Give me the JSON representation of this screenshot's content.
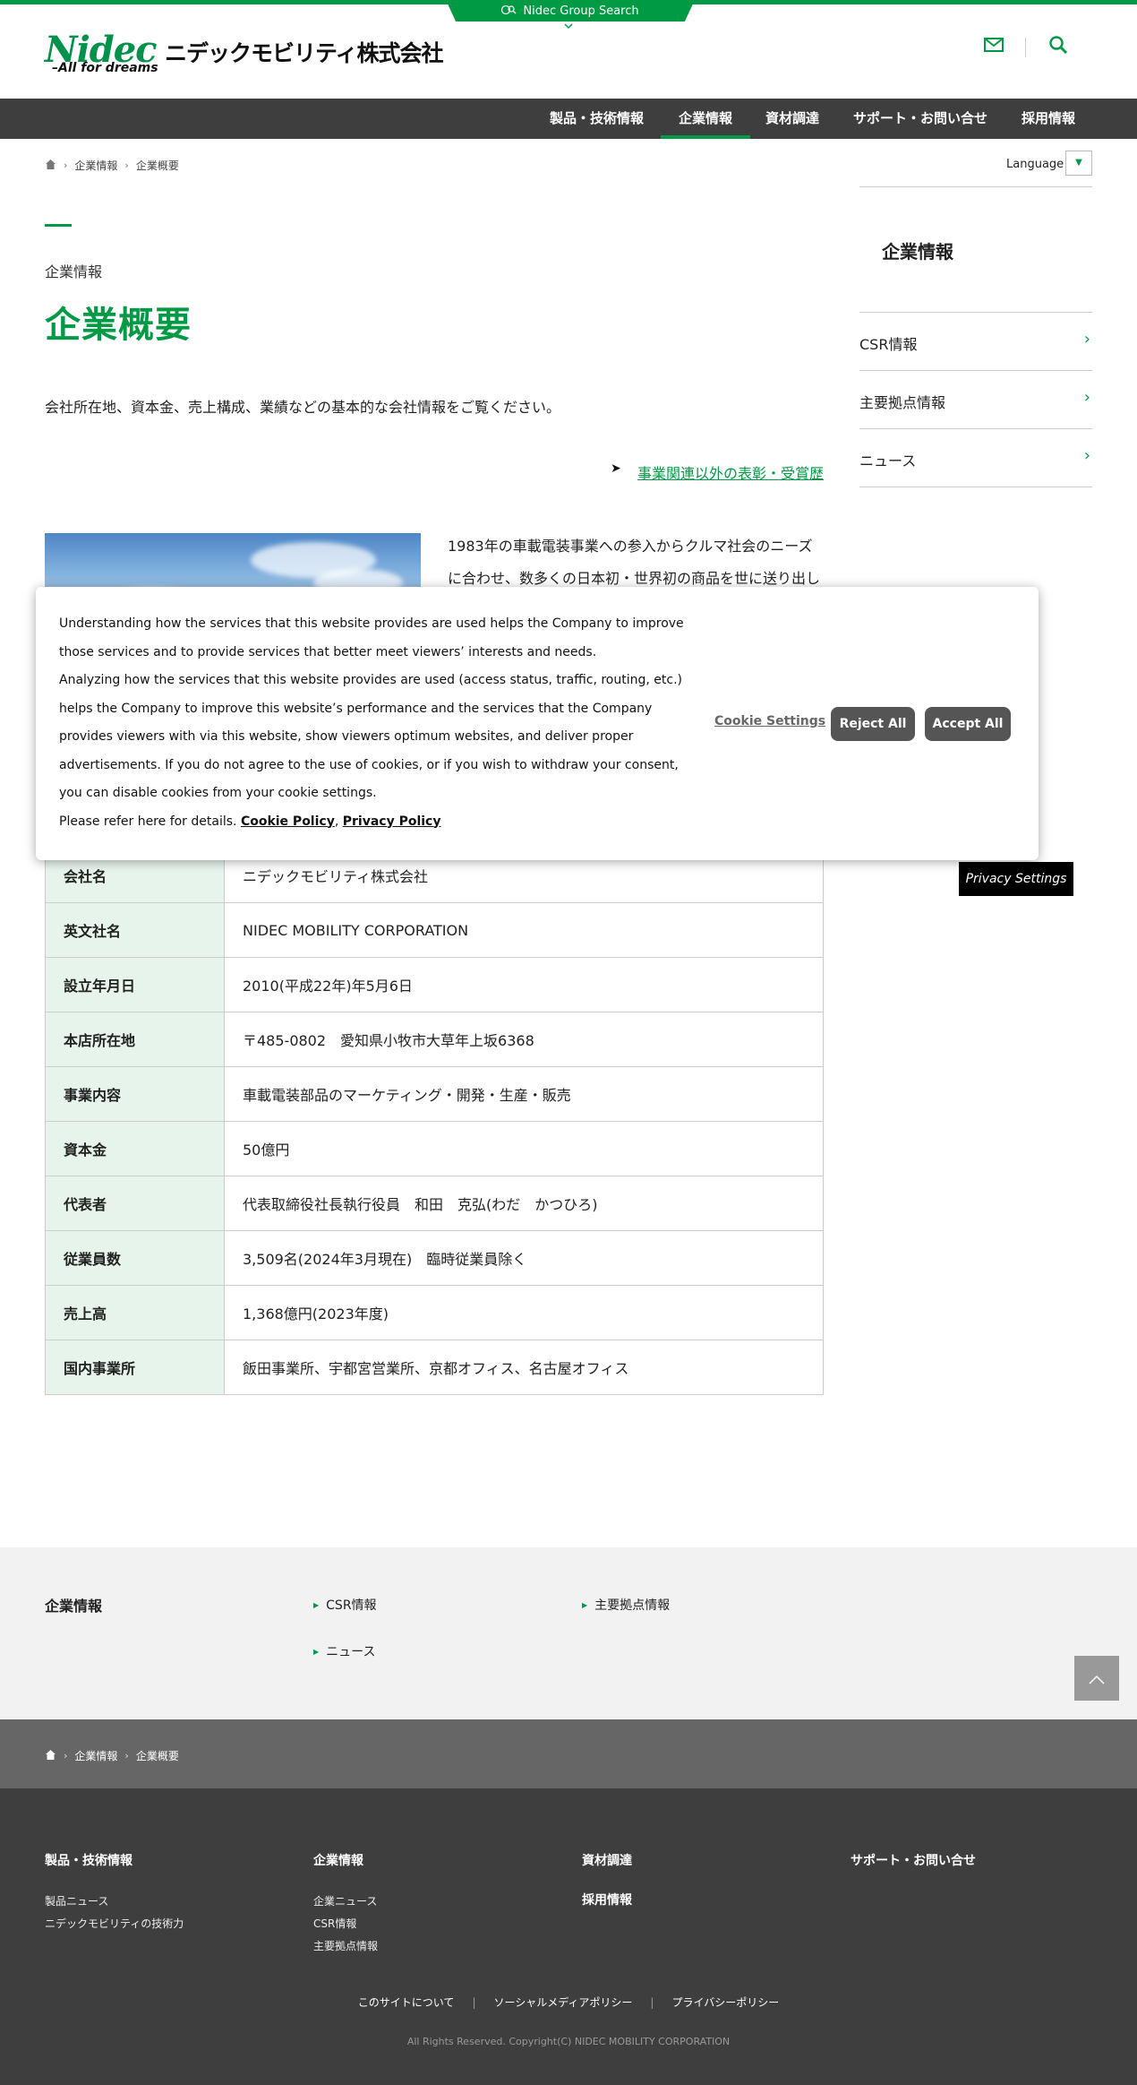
{
  "group_search": {
    "label": "Nidec Group Search"
  },
  "header": {
    "logo_word": "Nidec",
    "logo_tagline": "All for dreams",
    "logo_jp": "ニデックモビリティ株式会社"
  },
  "nav": {
    "items": [
      {
        "label": "製品・技術情報"
      },
      {
        "label": "企業情報"
      },
      {
        "label": "資材調達"
      },
      {
        "label": "サポート・お問い合せ"
      },
      {
        "label": "採用情報"
      }
    ]
  },
  "breadcrumb": {
    "level1": "企業情報",
    "level2": "企業概要"
  },
  "language": {
    "label": "Language"
  },
  "main": {
    "kicker": "企業情報",
    "title": "企業概要",
    "lead": "会社所在地、資本金、売上構成、業績などの基本的な会社情報をご覧ください。",
    "award_link": "事業関連以外の表彰・受賞歴",
    "intro": "1983年の車載電装事業への参入からクルマ社会のニーズに合わせ、数多くの日本初・世界初の商品を世に送り出して"
  },
  "sidebar": {
    "heading": "企業情報",
    "items": [
      {
        "label": "CSR情報"
      },
      {
        "label": "主要拠点情報"
      },
      {
        "label": "ニュース"
      }
    ]
  },
  "cookie": {
    "text1": "Understanding how the services that this website provides are used helps the Company to improve those services and to provide services that better meet viewers’ interests and needs.",
    "text2": "Analyzing how the services that this website provides are used (access status, traffic, routing, etc.) helps the Company to improve this website’s performance and the services that the Company provides viewers with via this website, show viewers optimum websites, and deliver proper advertisements. If you do not agree to the use of cookies, or if you wish to withdraw your consent, you can disable cookies from your cookie settings.",
    "text3": "Please refer here for details.",
    "cookie_policy": "Cookie Policy",
    "comma": ",",
    "privacy_policy": "Privacy Policy",
    "settings": "Cookie Settings",
    "reject": "Reject All",
    "accept": "Accept All",
    "privacy_settings": "Privacy Settings"
  },
  "table": {
    "rows": [
      {
        "key": "会社名",
        "value": "ニデックモビリティ株式会社"
      },
      {
        "key": "英文社名",
        "value": "NIDEC MOBILITY CORPORATION"
      },
      {
        "key": "設立年月日",
        "value": "2010(平成22年)年5月6日"
      },
      {
        "key": "本店所在地",
        "value": "〒485-0802　愛知県小牧市大草年上坂6368"
      },
      {
        "key": "事業内容",
        "value": "車載電装部品のマーケティング・開発・生産・販売"
      },
      {
        "key": "資本金",
        "value": "50億円"
      },
      {
        "key": "代表者",
        "value": "代表取締役社長執行役員　和田　克弘(わだ　かつひろ)"
      },
      {
        "key": "従業員数",
        "value": "3,509名(2024年3月現在)　臨時従業員除く"
      },
      {
        "key": "売上高",
        "value": "1,368億円(2023年度)"
      },
      {
        "key": "国内事業所",
        "value": "飯田事業所、宇都宮営業所、京都オフィス、名古屋オフィス"
      }
    ]
  },
  "footer_links": {
    "title": "企業情報",
    "items": [
      {
        "label": "CSR情報"
      },
      {
        "label": "主要拠点情報"
      },
      {
        "label": "ニュース"
      }
    ]
  },
  "footer": {
    "col1": {
      "head": "製品・技術情報",
      "links": [
        "製品ニュース",
        "ニデックモビリティの技術力"
      ]
    },
    "col2": {
      "head": "企業情報",
      "links": [
        "企業ニュース",
        "CSR情報",
        "主要拠点情報"
      ]
    },
    "col3": {
      "head": "資材調達",
      "head2": "採用情報"
    },
    "col4": {
      "head": "サポート・お問い合せ"
    },
    "bottom_links": [
      "このサイトについて",
      "ソーシャルメディアポリシー",
      "プライバシーポリシー"
    ],
    "copyright": "All Rights Reserved. Copyright(C) NIDEC MOBILITY CORPORATION"
  },
  "colors": {
    "brand_green": "#009a44",
    "nav_bg": "#3e3e3e",
    "table_key_bg": "#e6f4ec"
  }
}
